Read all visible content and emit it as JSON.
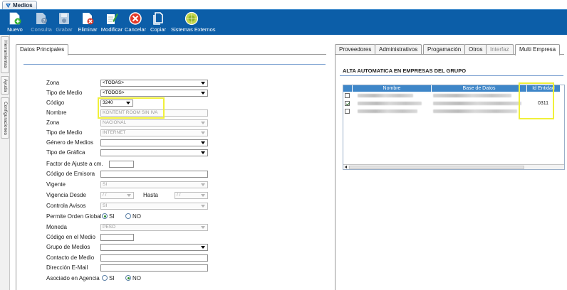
{
  "window_tab": {
    "title": "Medios"
  },
  "toolbar": {
    "nuevo": "Nuevo",
    "consulta": "Consulta",
    "grabar": "Grabar",
    "eliminar": "Eliminar",
    "modificar": "Modificar",
    "cancelar": "Cancelar",
    "copiar": "Copiar",
    "sistemas_externos": "Sistemas Externos"
  },
  "side_tabs": [
    "Herramientas",
    "Ayuda",
    "Configuraciones"
  ],
  "left_panel": {
    "tab_label": "Datos Principales",
    "fields": {
      "zona_filter": {
        "label": "Zona",
        "value": "<TODAS>"
      },
      "tipo_medio_filter": {
        "label": "Tipo de Medio",
        "value": "<TODOS>"
      },
      "codigo": {
        "label": "Código",
        "value": "3240"
      },
      "nombre": {
        "label": "Nombre",
        "value": "KONTENT ROOM SIN IVA"
      },
      "zona": {
        "label": "Zona",
        "value": "NACIONAL"
      },
      "tipo_medio": {
        "label": "Tipo de Medio",
        "value": "INTERNET"
      },
      "genero_medios": {
        "label": "Género de Medios",
        "value": ""
      },
      "tipo_grafica": {
        "label": "Tipo de Gráfica",
        "value": ""
      },
      "factor_ajuste": {
        "label": "Factor de Ajuste a cm.",
        "value": ""
      },
      "codigo_emisora": {
        "label": "Código de Emisora",
        "value": ""
      },
      "vigente": {
        "label": "Vigente",
        "value": "SI"
      },
      "vigencia_desde": {
        "label": "Vigencia Desde",
        "value": " /  /",
        "hasta_label": "Hasta",
        "hasta_value": " /  /"
      },
      "controla_avisos": {
        "label": "Controla Avisos",
        "value": "SI"
      },
      "permite_orden_global": {
        "label": "Permite Orden Global",
        "opt_si": "SI",
        "opt_no": "NO",
        "selected": "SI"
      },
      "moneda": {
        "label": "Moneda",
        "value": "PESO"
      },
      "codigo_en_medio": {
        "label": "Código en el Medio",
        "value": ""
      },
      "grupo_medios": {
        "label": "Grupo de Medios",
        "value": ""
      },
      "contacto_medio": {
        "label": "Contacto de Medio",
        "value": ""
      },
      "direccion_email": {
        "label": "Dirección E-Mail",
        "value": ""
      },
      "asociado_agencia": {
        "label": "Asociado en Agencia",
        "opt_si": "SI",
        "opt_no": "NO",
        "selected": "NO"
      }
    }
  },
  "right_panel": {
    "tabs": [
      "Proveedores",
      "Administrativos",
      "Progamación",
      "Otros",
      "Interfaz",
      "Multi Empresa"
    ],
    "active_tab": "Multi Empresa",
    "section_title": "ALTA AUTOMATICA EN EMPRESAS DEL GRUPO",
    "grid": {
      "columns": [
        "Nombre",
        "Base de Datos",
        "Id Entidad"
      ],
      "rows": [
        {
          "checked": false,
          "id_entidad": ""
        },
        {
          "checked": true,
          "id_entidad": "0311"
        },
        {
          "checked": false,
          "id_entidad": ""
        }
      ]
    }
  },
  "colors": {
    "toolbar_bg": "#0c5ea8",
    "grid_header": "#3e86c8",
    "highlight": "#f0f03a",
    "separator": "#7aa0d0"
  },
  "icons": [
    "nuevo-icon",
    "consulta-icon",
    "grabar-icon",
    "eliminar-icon",
    "modificar-icon",
    "cancelar-icon",
    "copiar-icon",
    "sistemas-externos-icon",
    "dropdown-arrow-icon",
    "checkbox-icon",
    "radio-icon"
  ]
}
